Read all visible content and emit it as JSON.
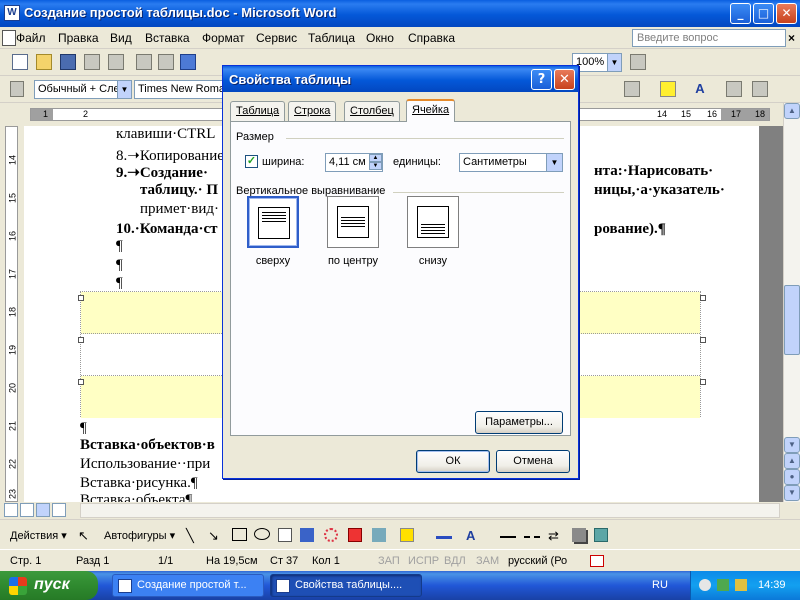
{
  "word_window": {
    "title": "Создание простой таблицы.doc - Microsoft Word",
    "app_icon_letter": "W",
    "minimize": "_",
    "maximize": "□",
    "close": "✕"
  },
  "menu": {
    "items": [
      "Файл",
      "Правка",
      "Вид",
      "Вставка",
      "Формат",
      "Сервис",
      "Таблица",
      "Окно",
      "Справка"
    ],
    "help_placeholder": "Введите вопрос",
    "close_doc": "×"
  },
  "toolbar": {
    "zoom": "100%",
    "style": "Обычный + Сле",
    "font": "Times New Roman",
    "font_color_label": "A"
  },
  "ruler": {
    "h_numbers": [
      "1",
      "2",
      "14",
      "15",
      "16",
      "17",
      "18"
    ],
    "v_numbers": [
      "14",
      "15",
      "16",
      "17",
      "18",
      "19",
      "20",
      "21",
      "22",
      "23"
    ]
  },
  "document": {
    "lines": [
      "клавиши·CTRL",
      "8.➝Копирование",
      "9.➝Создание·",
      "таблицу.· П",
      "примет·вид·",
      "10.·Команда·ст",
      "¶",
      "¶",
      "¶"
    ],
    "right_fragments": [
      "нта:·Нарисовать·",
      "ницы,·а·указатель·",
      "рование).¶"
    ],
    "after_table": [
      "¶",
      "Вставка·объектов·в",
      "Использование··при",
      "Вставка·рисунка.¶",
      "Вставка·объекта¶"
    ]
  },
  "dialog": {
    "title": "Свойства таблицы",
    "help_btn": "?",
    "close_btn": "✕",
    "tabs": [
      "Таблица",
      "Строка",
      "Столбец",
      "Ячейка"
    ],
    "active_tab": "Ячейка",
    "size_group": "Размер",
    "width_label": "ширина:",
    "width_checked": true,
    "width_value": "4,11 см",
    "units_label": "единицы:",
    "units_value": "Сантиметры",
    "valign_group": "Вертикальное выравнивание",
    "valign_options": [
      "сверху",
      "по центру",
      "снизу"
    ],
    "valign_selected": "сверху",
    "params_btn": "Параметры...",
    "ok_btn": "ОК",
    "cancel_btn": "Отмена"
  },
  "draw_toolbar": {
    "actions": "Действия ▾",
    "autoshapes": "Автофигуры ▾"
  },
  "status": {
    "page": "Стр. 1",
    "section": "Разд 1",
    "pages": "1/1",
    "at": "На 19,5см",
    "line": "Ст 37",
    "col": "Кол 1",
    "rec": "ЗАП",
    "trk": "ИСПР",
    "ext": "ВДЛ",
    "ovr": "ЗАМ",
    "lang": "русский (Ро"
  },
  "taskbar": {
    "start": "пуск",
    "tasks": [
      "Создание простой т...",
      "Свойства таблицы...."
    ],
    "lang": "RU",
    "clock": "14:39"
  },
  "colors": {
    "titlebar": "#0458d8",
    "table_shade": "#ffffc4",
    "tab_highlight": "#e68b2c"
  }
}
